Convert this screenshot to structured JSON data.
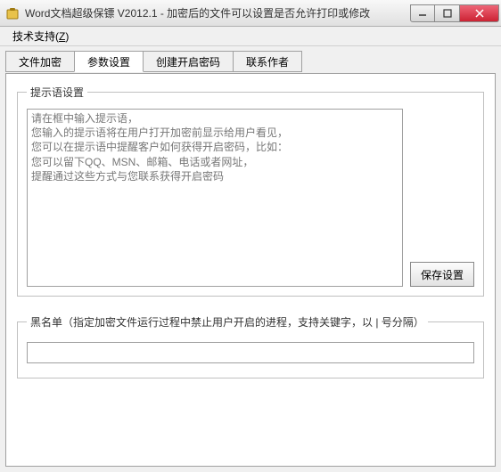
{
  "window": {
    "title": "Word文档超级保镖 V2012.1 - 加密后的文件可以设置是否允许打印或修改"
  },
  "menu": {
    "tech_support": "技术支持",
    "tech_support_key": "Z"
  },
  "tabs": {
    "items": [
      {
        "label": "文件加密"
      },
      {
        "label": "参数设置"
      },
      {
        "label": "创建开启密码"
      },
      {
        "label": "联系作者"
      }
    ],
    "active_index": 1
  },
  "hint_box": {
    "legend": "提示语设置",
    "text": "请在框中输入提示语，\n您输入的提示语将在用户打开加密前显示给用户看见，\n您可以在提示语中提醒客户如何获得开启密码，比如：\n您可以留下QQ、MSN、邮箱、电话或者网址，\n提醒通过这些方式与您联系获得开启密码",
    "save_label": "保存设置"
  },
  "blacklist_box": {
    "legend": "黑名单（指定加密文件运行过程中禁止用户开启的进程，支持关键字，以 | 号分隔）",
    "value": ""
  }
}
